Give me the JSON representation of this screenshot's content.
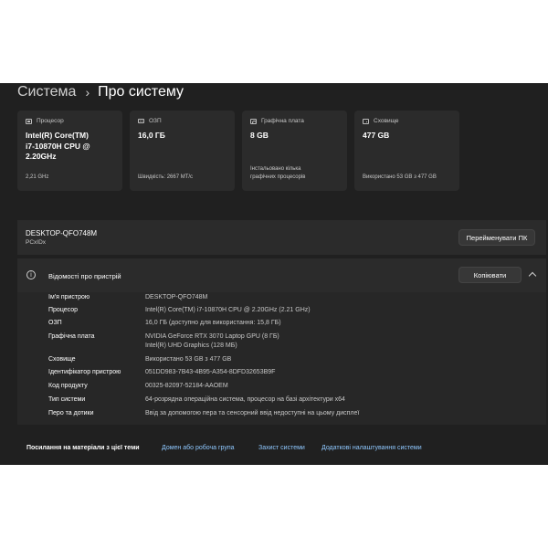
{
  "breadcrumb": {
    "parent": "Система",
    "separator": "›",
    "current": "Про систему"
  },
  "specs": [
    {
      "icon": "processor-icon",
      "title": "Процесор",
      "value": [
        "Intel(R) Core(TM)",
        "i7-10870H CPU @",
        "2.20GHz"
      ],
      "foot": [
        "2,21 GHz"
      ]
    },
    {
      "icon": "ram-icon",
      "title": "ОЗП",
      "value": [
        "16,0 ГБ"
      ],
      "foot": [
        "Швидкість: 2667 МТ/с"
      ]
    },
    {
      "icon": "graphics-card-icon",
      "title": "Графічна плата",
      "value": [
        "8 GB"
      ],
      "foot": [
        "Інстальовано кілька",
        "графічних процесорів"
      ]
    },
    {
      "icon": "storage-icon",
      "title": "Сховище",
      "value": [
        "477 GB"
      ],
      "foot": [
        "Використано 53 GB з 477 GB"
      ]
    }
  ],
  "device": {
    "name": "DESKTOP-QFO748M",
    "model": "PCxIDx",
    "rename_label": "Перейменувати ПК"
  },
  "info": {
    "title": "Відомості про пристрій",
    "copy_label": "Копіювати",
    "rows": [
      {
        "label": "Ім'я пристрою",
        "value": [
          "DESKTOP-QFO748M"
        ]
      },
      {
        "label": "Процесор",
        "value": [
          "Intel(R) Core(TM) i7-10870H CPU @ 2.20GHz (2.21 GHz)"
        ]
      },
      {
        "label": "ОЗП",
        "value": [
          "16,0 ГБ (доступно для використання: 15,8 ГБ)"
        ]
      },
      {
        "label": "Графічна плата",
        "value": [
          "NVIDIA GeForce RTX 3070 Laptop GPU (8 ГБ)",
          "Intel(R) UHD Graphics (128 МБ)"
        ]
      },
      {
        "label": "Сховище",
        "value": [
          "Використано 53 GB з 477 GB"
        ]
      },
      {
        "label": "Ідентифікатор пристрою",
        "value": [
          "051DD983-7B43-4B95-A354-8DFD32653B9F"
        ]
      },
      {
        "label": "Код продукту",
        "value": [
          "00325-82097-52184-AAOEM"
        ]
      },
      {
        "label": "Тип системи",
        "value": [
          "64-розрядна операційна система, процесор на базі архітектури x64"
        ]
      },
      {
        "label": "Перо та дотики",
        "value": [
          "Ввід за допомогою пера та сенсорний ввід недоступні на цьому дисплеї"
        ]
      }
    ]
  },
  "related": {
    "label": "Посилання на матеріали з цієї теми",
    "links": [
      "Домен або робоча група",
      "Захист системи",
      "Додаткові налаштування системи"
    ]
  },
  "colors": {
    "window_bg": "#202020",
    "card_bg": "#2b2b2b",
    "link": "#8fc8ff"
  }
}
